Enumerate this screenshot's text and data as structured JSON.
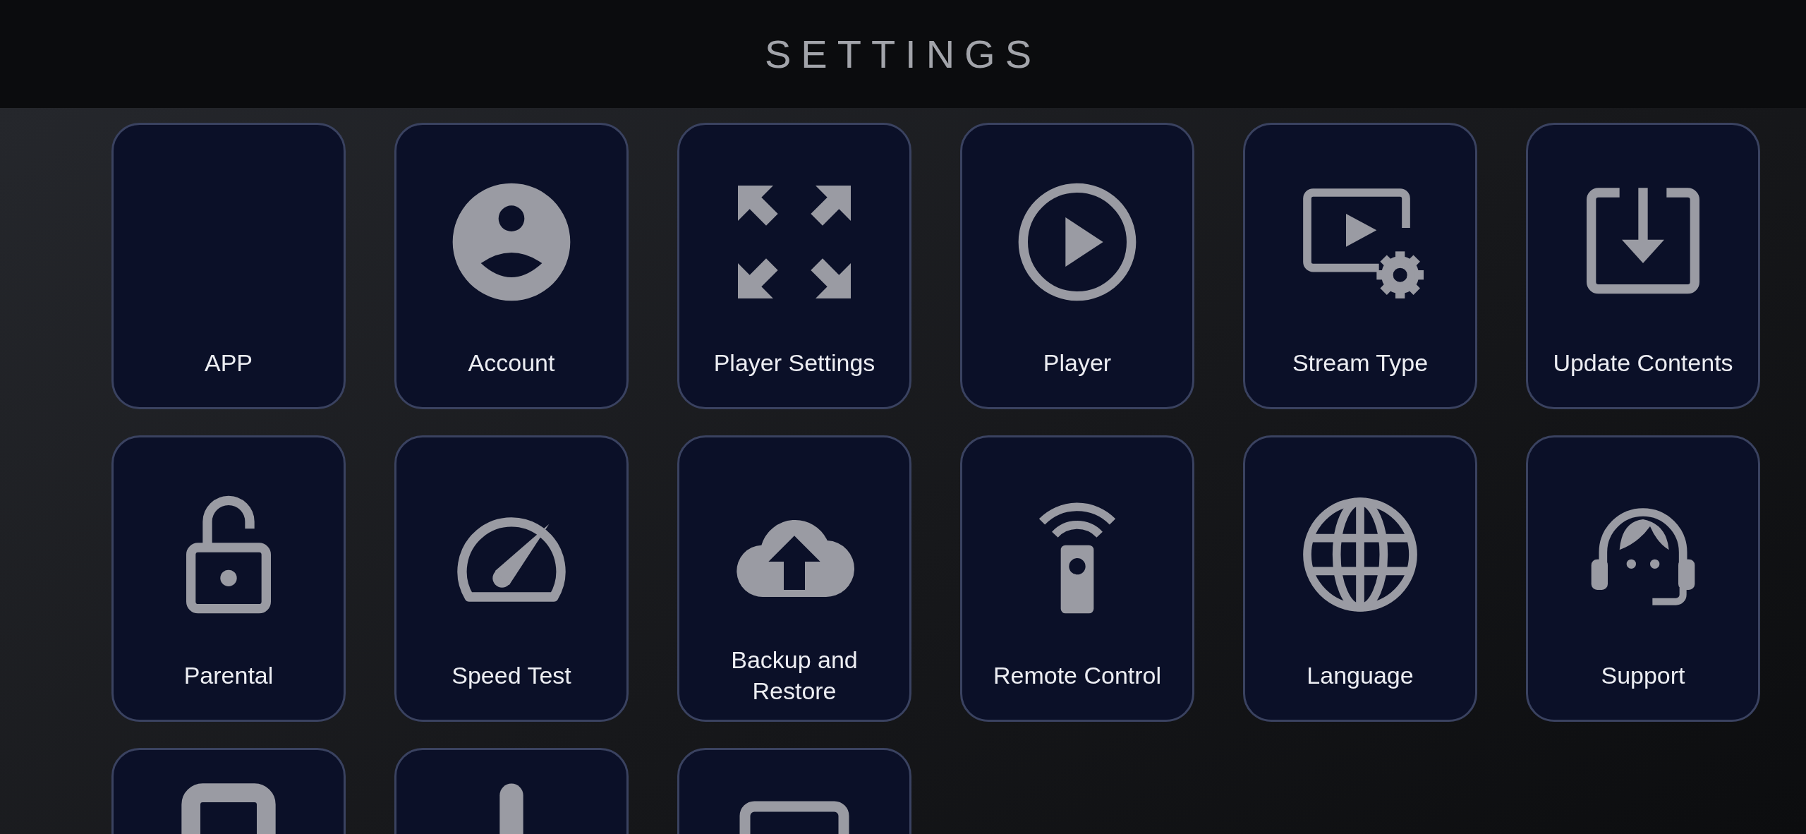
{
  "header": {
    "title": "SETTINGS"
  },
  "tiles": [
    {
      "kind": "labeled",
      "label": "APP"
    },
    {
      "kind": "labeled",
      "label": "Account"
    },
    {
      "kind": "labeled",
      "label": "Player Settings"
    },
    {
      "kind": "labeled",
      "label": "Player"
    },
    {
      "kind": "labeled",
      "label": "Stream Type"
    },
    {
      "kind": "labeled",
      "label": "Update Contents"
    },
    {
      "kind": "labeled",
      "label": "Parental"
    },
    {
      "kind": "labeled",
      "label": "Speed Test"
    },
    {
      "kind": "labeled",
      "label": "Backup and Restore"
    },
    {
      "kind": "labeled",
      "label": "Remote Control"
    },
    {
      "kind": "labeled",
      "label": "Language"
    },
    {
      "kind": "labeled",
      "label": "Support"
    },
    {
      "kind": "cut_off"
    },
    {
      "kind": "cut_off"
    },
    {
      "kind": "cut_off"
    }
  ]
}
